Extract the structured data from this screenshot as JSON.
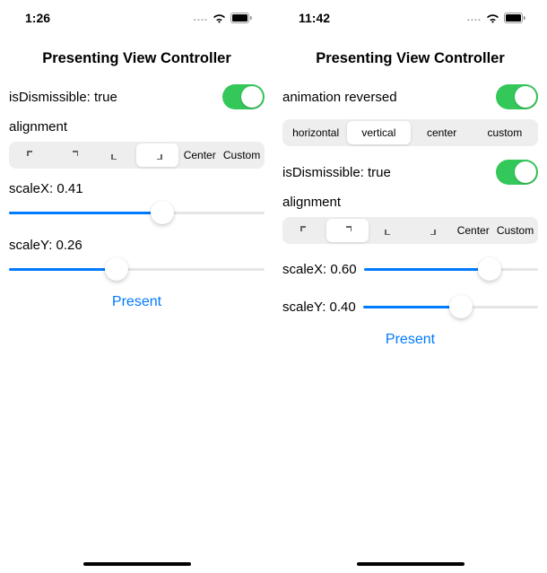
{
  "left": {
    "status_time": "1:26",
    "title": "Presenting View Controller",
    "dismissible_label": "isDismissible: true",
    "alignment_label": "alignment",
    "seg_opts": [
      "tl",
      "tr",
      "bl",
      "br",
      "Center",
      "Custom"
    ],
    "seg_selected": 3,
    "scaleX_label": "scaleX: 0.41",
    "scaleX_value": 0.41,
    "scaleY_label": "scaleY: 0.26",
    "scaleY_value": 0.26,
    "present": "Present"
  },
  "right": {
    "status_time": "11:42",
    "title": "Presenting View Controller",
    "anim_label": "animation reversed",
    "anim_opts": [
      "horizontal",
      "vertical",
      "center",
      "custom"
    ],
    "anim_selected": 1,
    "dismissible_label": "isDismissible: true",
    "alignment_label": "alignment",
    "seg_opts": [
      "tl",
      "tr",
      "bl",
      "br",
      "Center",
      "Custom"
    ],
    "seg_selected": 1,
    "scaleX_label": "scaleX: 0.60",
    "scaleX_value": 0.6,
    "scaleY_label": "scaleY: 0.40",
    "scaleY_value": 0.4,
    "present": "Present"
  },
  "colors": {
    "accent": "#007aff",
    "toggle_on": "#34c759"
  }
}
